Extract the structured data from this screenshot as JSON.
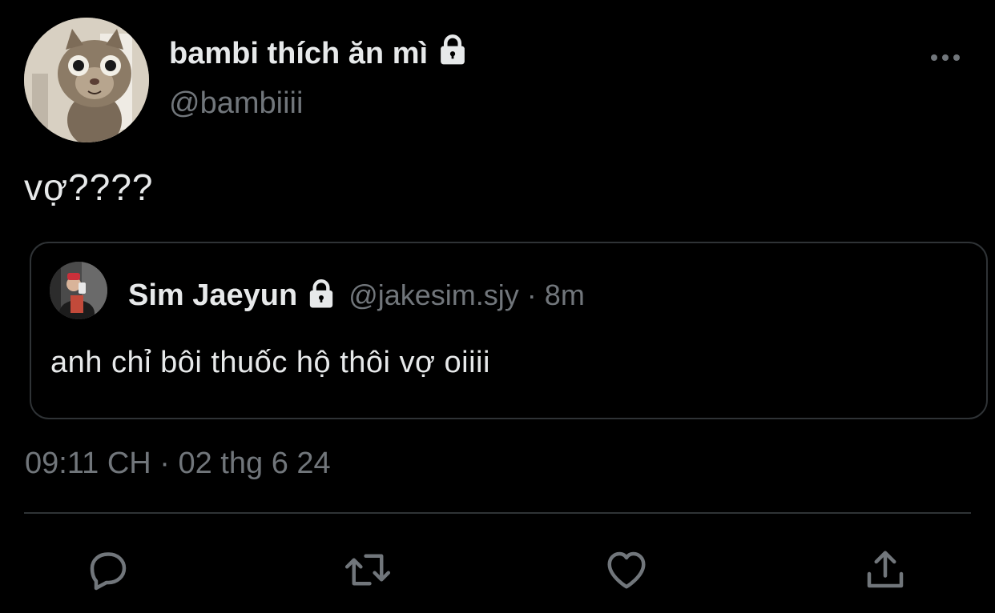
{
  "author": {
    "display_name": "bambi thích ăn mì",
    "handle": "@bambiiii",
    "protected_icon": "lock-icon",
    "avatar": "cat-photo-avatar"
  },
  "more_icon": "more-horizontal-icon",
  "tweet": {
    "text": "vợ????"
  },
  "quoted_tweet": {
    "display_name": "Sim Jaeyun",
    "protected_icon": "lock-icon",
    "handle": "@jakesim.sjy",
    "separator": "·",
    "time": "8m",
    "text": "anh chỉ bôi thuốc hộ thôi vợ oiiii",
    "avatar": "mirror-selfie-avatar"
  },
  "timestamp": "09:11 CH · 02 thg 6 24",
  "actions": {
    "reply_icon": "reply-icon",
    "retweet_icon": "retweet-icon",
    "like_icon": "heart-icon",
    "share_icon": "share-icon"
  },
  "colors": {
    "background": "#000000",
    "primary_text": "#e7e9ea",
    "secondary_text": "#71767b",
    "border": "#2f3336"
  }
}
